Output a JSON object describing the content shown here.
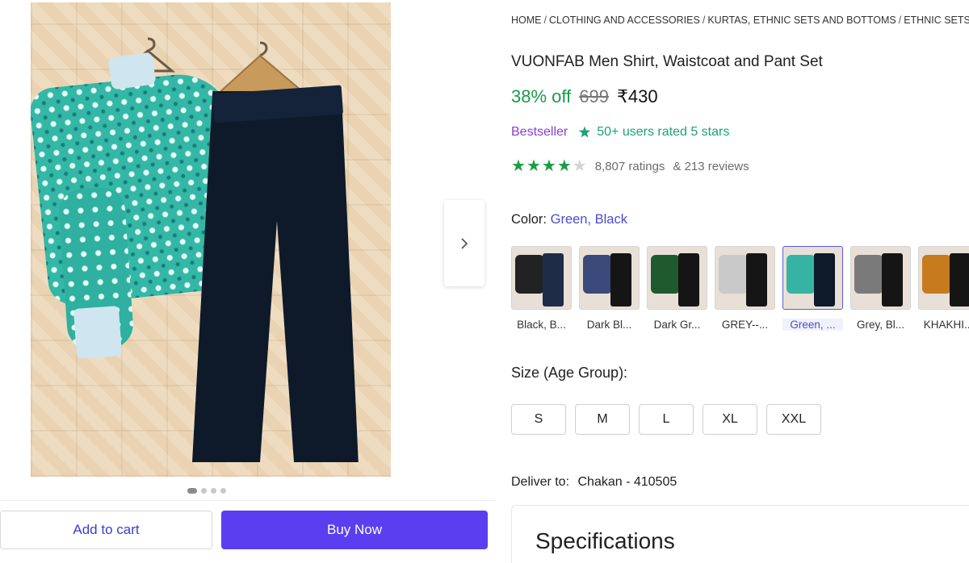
{
  "carousel": {
    "image_alt": "VUONFAB Men Shirt, Waistcoat and Pant Set",
    "dots": 4,
    "active_dot": 0
  },
  "actions": {
    "add_to_cart": "Add to cart",
    "buy_now": "Buy Now"
  },
  "breadcrumb": [
    "HOME",
    "CLOTHING AND ACCESSORIES",
    "KURTAS, ETHNIC SETS AND BOTTOMS",
    "ETHNIC SETS"
  ],
  "product": {
    "title": "VUONFAB Men Shirt, Waistcoat and Pant Set",
    "discount": "38% off",
    "mrp": "699",
    "price": "₹430",
    "bestseller": "Bestseller",
    "rated_badge": "50+ users rated 5 stars",
    "rating_stars": 4,
    "ratings_count": "8,807 ratings",
    "reviews_count": "& 213 reviews"
  },
  "color": {
    "label": "Color:",
    "selected": "Green, Black",
    "options": [
      {
        "label": "Black, B...",
        "top": "#222222",
        "bottom": "#1e2c4a"
      },
      {
        "label": "Dark Bl...",
        "top": "#3b4a7a",
        "bottom": "#151515"
      },
      {
        "label": "Dark Gr...",
        "top": "#1f5a2e",
        "bottom": "#151515"
      },
      {
        "label": "GREY--...",
        "top": "#c9c9c9",
        "bottom": "#151515"
      },
      {
        "label": "Green, ...",
        "top": "#36b3a3",
        "bottom": "#0e1a2a"
      },
      {
        "label": "Grey, Bl...",
        "top": "#7a7a7a",
        "bottom": "#151515"
      },
      {
        "label": "KHAKHI...",
        "top": "#c77a1e",
        "bottom": "#151515"
      }
    ],
    "selected_index": 4
  },
  "size": {
    "label": "Size (Age Group):",
    "options": [
      "S",
      "M",
      "L",
      "XL",
      "XXL"
    ]
  },
  "delivery": {
    "label": "Deliver to:",
    "location": "Chakan - 410505"
  },
  "specifications": {
    "title": "Specifications"
  },
  "colors": {
    "brand": "#5b3ef0",
    "discount": "#1a9a4a",
    "bestseller": "#8a3fd1",
    "rated": "#1ea27b",
    "link": "#4b4bd0"
  }
}
